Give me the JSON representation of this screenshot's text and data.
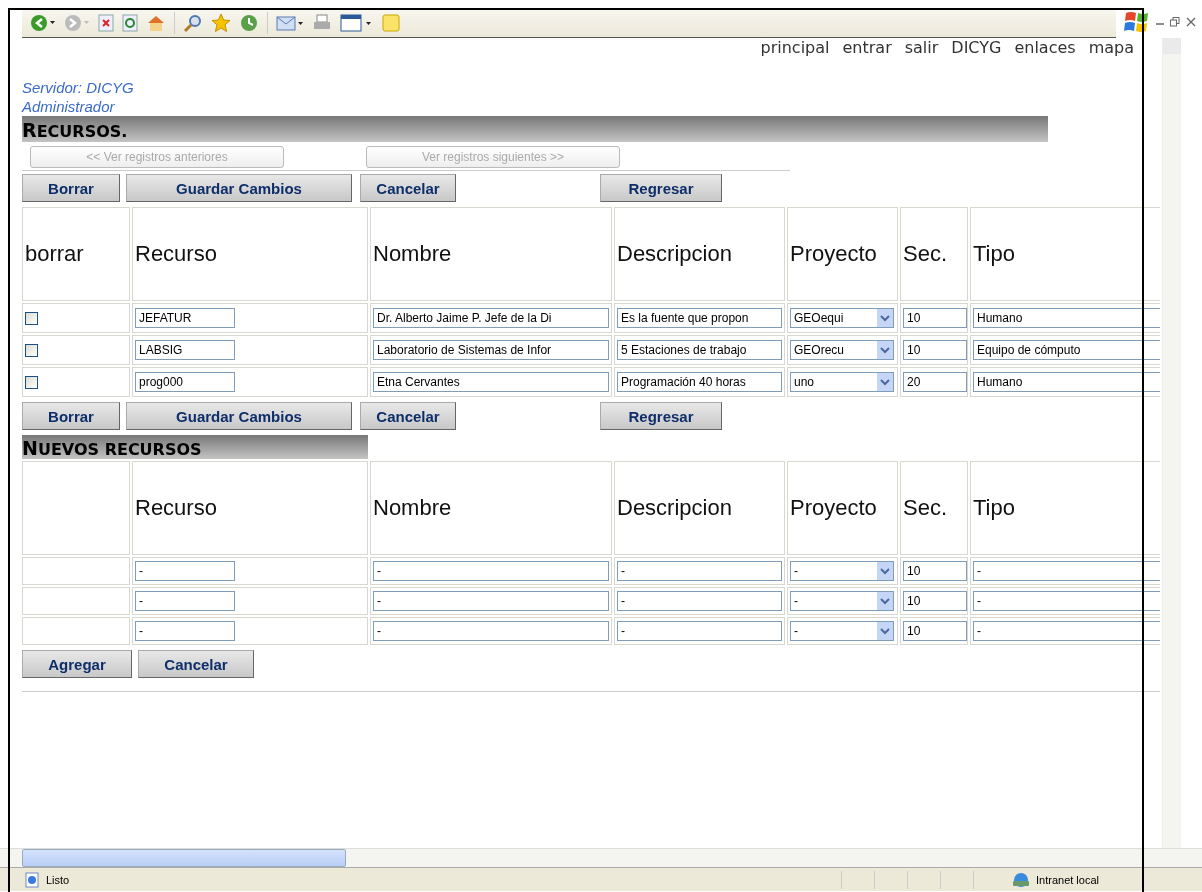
{
  "nav_links": [
    "principal",
    "entrar",
    "salir",
    "DICYG",
    "enlaces",
    "mapa"
  ],
  "server": "Servidor: DICYG",
  "role": "Administrador",
  "resources": {
    "title": "RECURSOS.",
    "pager": [
      {
        "label": "<< Ver registros anteriores",
        "disabled": true
      },
      {
        "label": "Ver registros siguientes >>",
        "disabled": true
      }
    ],
    "buttons_top": [
      "Borrar",
      "Guardar Cambios",
      "Cancelar",
      "Regresar"
    ],
    "columns": [
      "borrar",
      "Recurso",
      "Nombre",
      "Descripcion",
      "Proyecto",
      "Sec.",
      "Tipo"
    ],
    "rows": [
      {
        "checked": false,
        "recurso": "JEFATUR",
        "nombre": "Dr. Alberto Jaime P. Jefe de la Di",
        "descripcion": "Es la fuente que propon",
        "proyecto": "GEOequi",
        "sec": "10",
        "tipo": "Humano"
      },
      {
        "checked": false,
        "recurso": "LABSIG",
        "nombre": "Laboratorio de Sistemas de Infor",
        "descripcion": "5 Estaciones de trabajo",
        "proyecto": "GEOrecu",
        "sec": "10",
        "tipo": "Equipo de cómputo"
      },
      {
        "checked": false,
        "recurso": "prog000",
        "nombre": "Etna Cervantes",
        "descripcion": "Programación 40 horas",
        "proyecto": "uno",
        "sec": "20",
        "tipo": "Humano"
      }
    ],
    "buttons_bottom": [
      "Borrar",
      "Guardar Cambios",
      "Cancelar",
      "Regresar"
    ]
  },
  "new_resources": {
    "title": "NUEVOS RECURSOS",
    "columns": [
      "Recurso",
      "Nombre",
      "Descripcion",
      "Proyecto",
      "Sec.",
      "Tipo"
    ],
    "rows": [
      {
        "recurso": "-",
        "nombre": "-",
        "descripcion": "-",
        "proyecto": "-",
        "sec": "10",
        "tipo": "-"
      },
      {
        "recurso": "-",
        "nombre": "-",
        "descripcion": "-",
        "proyecto": "-",
        "sec": "10",
        "tipo": "-"
      },
      {
        "recurso": "-",
        "nombre": "-",
        "descripcion": "-",
        "proyecto": "-",
        "sec": "10",
        "tipo": "-"
      }
    ],
    "buttons": [
      "Agregar",
      "Cancelar"
    ]
  },
  "status_bar": {
    "status": "Listo",
    "zone": "Intranet local"
  }
}
